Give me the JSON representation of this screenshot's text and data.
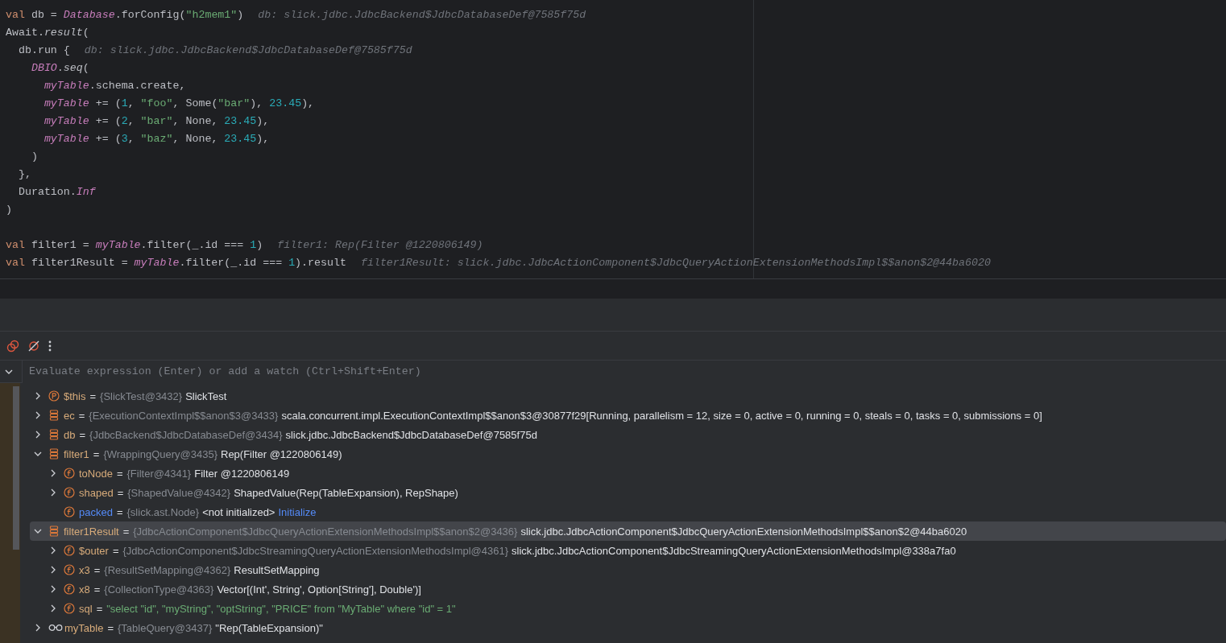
{
  "editor": {
    "blocks": [
      {
        "lines": [
          {
            "tokens": [
              {
                "kind": "kw",
                "text": "val"
              },
              {
                "kind": "plain",
                "text": " db = "
              },
              {
                "kind": "ident",
                "text": "Database"
              },
              {
                "kind": "plain",
                "text": ".forConfig("
              },
              {
                "kind": "str",
                "text": "\"h2mem1\""
              },
              {
                "kind": "plain",
                "text": ")"
              }
            ],
            "hint": "db: slick.jdbc.JdbcBackend$JdbcDatabaseDef@7585f75d"
          },
          {
            "tokens": [
              {
                "kind": "plain",
                "text": "Await."
              },
              {
                "kind": "italic",
                "text": "result"
              },
              {
                "kind": "plain",
                "text": "("
              }
            ]
          },
          {
            "tokens": [
              {
                "kind": "plain",
                "text": "  db.run {"
              }
            ],
            "hint": "db: slick.jdbc.JdbcBackend$JdbcDatabaseDef@7585f75d"
          },
          {
            "tokens": [
              {
                "kind": "ident",
                "text": "    DBIO"
              },
              {
                "kind": "plain",
                "text": "."
              },
              {
                "kind": "italic",
                "text": "seq"
              },
              {
                "kind": "plain",
                "text": "("
              }
            ]
          },
          {
            "tokens": [
              {
                "kind": "ident",
                "text": "      myTable"
              },
              {
                "kind": "plain",
                "text": ".schema.create,"
              }
            ]
          },
          {
            "tokens": [
              {
                "kind": "ident",
                "text": "      myTable"
              },
              {
                "kind": "plain",
                "text": " += ("
              },
              {
                "kind": "num",
                "text": "1"
              },
              {
                "kind": "plain",
                "text": ", "
              },
              {
                "kind": "str",
                "text": "\"foo\""
              },
              {
                "kind": "plain",
                "text": ", Some("
              },
              {
                "kind": "str",
                "text": "\"bar\""
              },
              {
                "kind": "plain",
                "text": "), "
              },
              {
                "kind": "num",
                "text": "23.45"
              },
              {
                "kind": "plain",
                "text": "),"
              }
            ]
          },
          {
            "tokens": [
              {
                "kind": "ident",
                "text": "      myTable"
              },
              {
                "kind": "plain",
                "text": " += ("
              },
              {
                "kind": "num",
                "text": "2"
              },
              {
                "kind": "plain",
                "text": ", "
              },
              {
                "kind": "str",
                "text": "\"bar\""
              },
              {
                "kind": "plain",
                "text": ", None, "
              },
              {
                "kind": "num",
                "text": "23.45"
              },
              {
                "kind": "plain",
                "text": "),"
              }
            ]
          },
          {
            "tokens": [
              {
                "kind": "ident",
                "text": "      myTable"
              },
              {
                "kind": "plain",
                "text": " += ("
              },
              {
                "kind": "num",
                "text": "3"
              },
              {
                "kind": "plain",
                "text": ", "
              },
              {
                "kind": "str",
                "text": "\"baz\""
              },
              {
                "kind": "plain",
                "text": ", None, "
              },
              {
                "kind": "num",
                "text": "23.45"
              },
              {
                "kind": "plain",
                "text": "),"
              }
            ]
          },
          {
            "tokens": [
              {
                "kind": "plain",
                "text": "    )"
              }
            ]
          },
          {
            "tokens": [
              {
                "kind": "plain",
                "text": "  },"
              }
            ]
          },
          {
            "tokens": [
              {
                "kind": "plain",
                "text": "  Duration."
              },
              {
                "kind": "ident",
                "text": "Inf"
              }
            ]
          },
          {
            "tokens": [
              {
                "kind": "plain",
                "text": ")"
              }
            ]
          }
        ]
      },
      {
        "lines": [
          {
            "tokens": [
              {
                "kind": "kw",
                "text": "val"
              },
              {
                "kind": "plain",
                "text": " filter1 = "
              },
              {
                "kind": "ident",
                "text": "myTable"
              },
              {
                "kind": "plain",
                "text": ".filter(_.id === "
              },
              {
                "kind": "num",
                "text": "1"
              },
              {
                "kind": "plain",
                "text": ")"
              }
            ],
            "hint": "filter1: Rep(Filter @1220806149)"
          },
          {
            "tokens": [
              {
                "kind": "kw",
                "text": "val"
              },
              {
                "kind": "plain",
                "text": " filter1Result = "
              },
              {
                "kind": "ident",
                "text": "myTable"
              },
              {
                "kind": "plain",
                "text": ".filter(_.id === "
              },
              {
                "kind": "num",
                "text": "1"
              },
              {
                "kind": "plain",
                "text": ").result"
              }
            ],
            "hint": "filter1Result: slick.jdbc.JdbcActionComponent$JdbcQueryActionExtensionMethodsImpl$$anon$2@44ba6020"
          }
        ]
      }
    ]
  },
  "debugger": {
    "evaluate": {
      "placeholder": "Evaluate expression (Enter) or add a watch (Ctrl+Shift+Enter)"
    },
    "variables": [
      {
        "kind": "param",
        "name": "$this",
        "sep": "=",
        "type": "{SlickTest@3432}",
        "value": "SlickTest",
        "expanded": false,
        "selected": false
      },
      {
        "kind": "object",
        "name": "ec",
        "sep": "=",
        "type": "{ExecutionContextImpl$$anon$3@3433}",
        "value": "scala.concurrent.impl.ExecutionContextImpl$$anon$3@30877f29[Running, parallelism = 12, size = 0, active = 0, running = 0, steals = 0, tasks = 0, submissions = 0]",
        "expanded": false,
        "selected": false
      },
      {
        "kind": "object",
        "name": "db",
        "sep": "=",
        "type": "{JdbcBackend$JdbcDatabaseDef@3434}",
        "value": "slick.jdbc.JdbcBackend$JdbcDatabaseDef@7585f75d",
        "expanded": false,
        "selected": false
      },
      {
        "kind": "object",
        "name": "filter1",
        "sep": "=",
        "type": "{WrappingQuery@3435}",
        "value": "Rep(Filter @1220806149)",
        "expanded": true,
        "selected": false,
        "children": [
          {
            "kind": "field",
            "name": "toNode",
            "sep": "=",
            "type": "{Filter@4341}",
            "value": "Filter @1220806149",
            "expanded": false,
            "selected": false
          },
          {
            "kind": "field",
            "name": "shaped",
            "sep": "=",
            "type": "{ShapedValue@4342}",
            "value": "ShapedValue(Rep(TableExpansion), RepShape)",
            "expanded": false,
            "selected": false
          },
          {
            "kind": "field",
            "name": "packed",
            "sep": "=",
            "type": "{slick.ast.Node}",
            "value": "<not initialized>",
            "link": "Initialize",
            "selected": false
          }
        ]
      },
      {
        "kind": "object",
        "name": "filter1Result",
        "sep": "=",
        "type": "{JdbcActionComponent$JdbcQueryActionExtensionMethodsImpl$$anon$2@3436}",
        "value": "slick.jdbc.JdbcActionComponent$JdbcQueryActionExtensionMethodsImpl$$anon$2@44ba6020",
        "expanded": true,
        "selected": true,
        "children": [
          {
            "kind": "field",
            "name": "$outer",
            "sep": "=",
            "type": "{JdbcActionComponent$JdbcStreamingQueryActionExtensionMethodsImpl@4361}",
            "value": "slick.jdbc.JdbcActionComponent$JdbcStreamingQueryActionExtensionMethodsImpl@338a7fa0",
            "expanded": false,
            "selected": false
          },
          {
            "kind": "field",
            "name": "x3",
            "sep": "=",
            "type": "{ResultSetMapping@4362}",
            "value": "ResultSetMapping",
            "expanded": false,
            "selected": false
          },
          {
            "kind": "field",
            "name": "x8",
            "sep": "=",
            "type": "{CollectionType@4363}",
            "value": "Vector[(Int', String', Option[String'], Double')]",
            "expanded": false,
            "selected": false
          },
          {
            "kind": "field",
            "name": "sql",
            "sep": "=",
            "string": "\"select \"id\", \"myString\", \"optString\", \"PRICE\" from \"MyTable\" where \"id\" = 1\"",
            "expanded": false,
            "selected": false
          }
        ]
      },
      {
        "kind": "watch",
        "name": "myTable",
        "sep": "=",
        "type": "{TableQuery@3437}",
        "value": "\"Rep(TableExpansion)\"",
        "expanded": false,
        "selected": false
      }
    ]
  }
}
